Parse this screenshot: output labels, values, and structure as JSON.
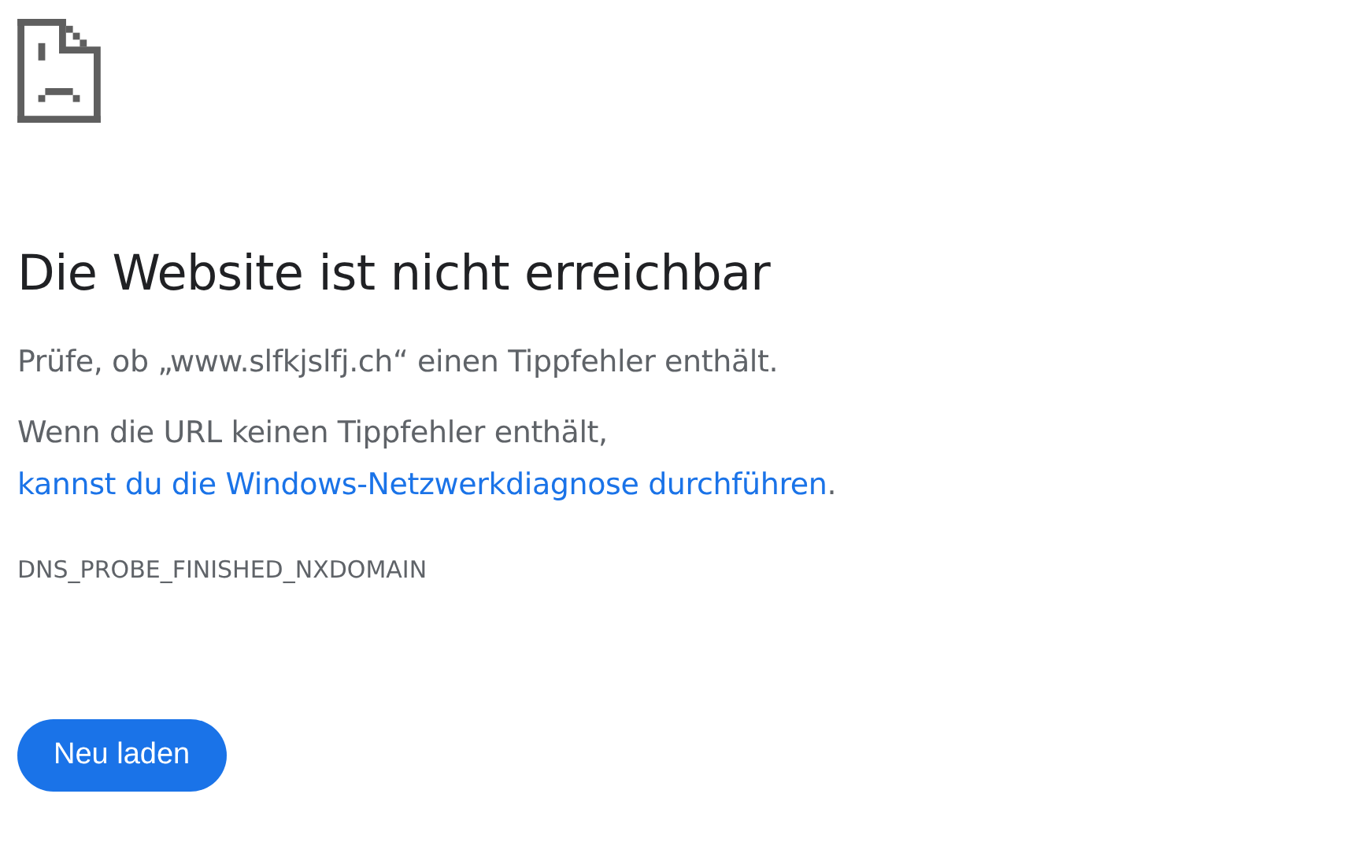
{
  "heading": "Die Website ist nicht erreichbar",
  "paragraphs": [
    {
      "text": "Prüfe, ob „www.slfkjslfj.ch“ einen Tippfehler enthält."
    },
    {
      "text": "Wenn die URL keinen Tippfehler enthält,",
      "link": "kannst du die Windows-Netzwerkdiagnose durchführen",
      "after": "."
    }
  ],
  "error_code": "DNS_PROBE_FINISHED_NXDOMAIN",
  "button": {
    "label": "Neu laden"
  }
}
